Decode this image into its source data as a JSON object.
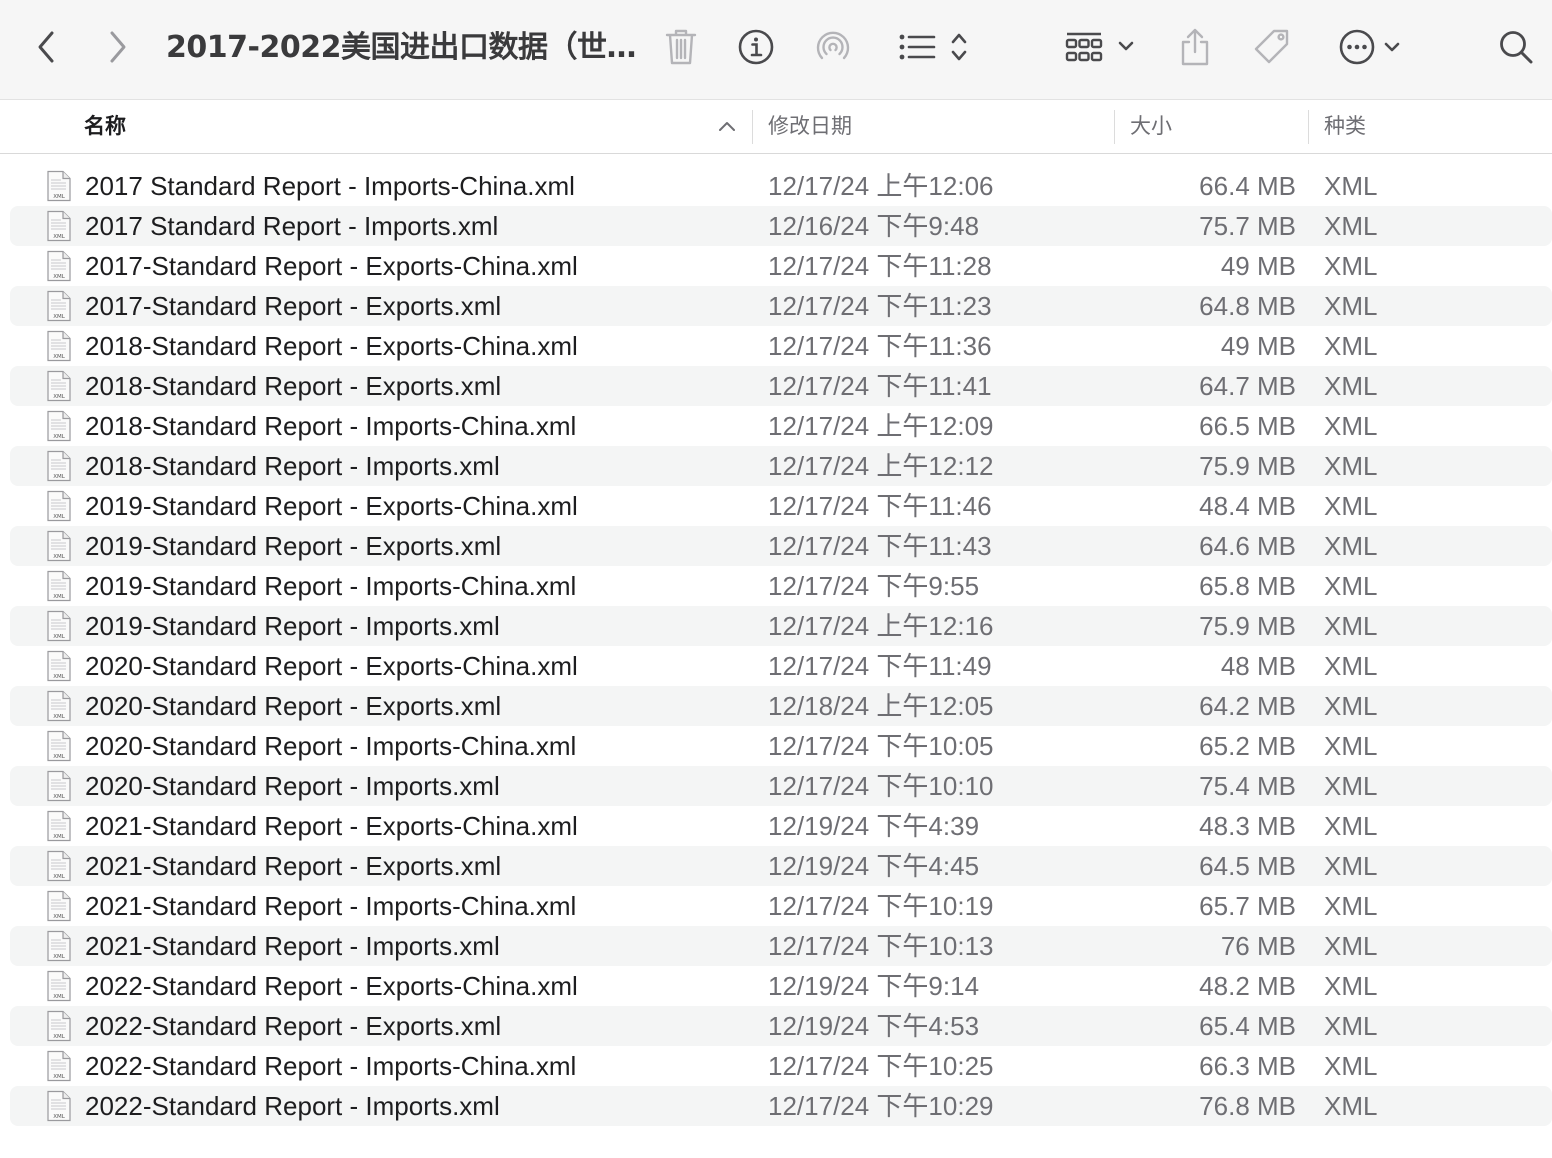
{
  "window": {
    "title": "2017-2022美国进出口数据（世…"
  },
  "icons": {
    "back": "chevron-left-icon",
    "forward": "chevron-right-icon",
    "trash": "trash-icon",
    "info": "info-icon",
    "airdrop": "airdrop-icon",
    "list_view": "list-view-icon",
    "group": "group-icon",
    "share": "share-icon",
    "tag": "tag-icon",
    "more": "more-icon",
    "search": "search-icon"
  },
  "columns": {
    "name": "名称",
    "date": "修改日期",
    "size": "大小",
    "kind": "种类"
  },
  "files": [
    {
      "name": "2017 Standard Report - Imports-China.xml",
      "date": "12/17/24 上午12:06",
      "size": "66.4 MB",
      "kind": "XML"
    },
    {
      "name": "2017 Standard Report - Imports.xml",
      "date": "12/16/24 下午9:48",
      "size": "75.7 MB",
      "kind": "XML"
    },
    {
      "name": "2017-Standard Report - Exports-China.xml",
      "date": "12/17/24 下午11:28",
      "size": "49 MB",
      "kind": "XML"
    },
    {
      "name": "2017-Standard Report - Exports.xml",
      "date": "12/17/24 下午11:23",
      "size": "64.8 MB",
      "kind": "XML"
    },
    {
      "name": "2018-Standard Report - Exports-China.xml",
      "date": "12/17/24 下午11:36",
      "size": "49 MB",
      "kind": "XML"
    },
    {
      "name": "2018-Standard Report - Exports.xml",
      "date": "12/17/24 下午11:41",
      "size": "64.7 MB",
      "kind": "XML"
    },
    {
      "name": "2018-Standard Report - Imports-China.xml",
      "date": "12/17/24 上午12:09",
      "size": "66.5 MB",
      "kind": "XML"
    },
    {
      "name": "2018-Standard Report - Imports.xml",
      "date": "12/17/24 上午12:12",
      "size": "75.9 MB",
      "kind": "XML"
    },
    {
      "name": "2019-Standard Report - Exports-China.xml",
      "date": "12/17/24 下午11:46",
      "size": "48.4 MB",
      "kind": "XML"
    },
    {
      "name": "2019-Standard Report - Exports.xml",
      "date": "12/17/24 下午11:43",
      "size": "64.6 MB",
      "kind": "XML"
    },
    {
      "name": "2019-Standard Report - Imports-China.xml",
      "date": "12/17/24 下午9:55",
      "size": "65.8 MB",
      "kind": "XML"
    },
    {
      "name": "2019-Standard Report - Imports.xml",
      "date": "12/17/24 上午12:16",
      "size": "75.9 MB",
      "kind": "XML"
    },
    {
      "name": "2020-Standard Report - Exports-China.xml",
      "date": "12/17/24 下午11:49",
      "size": "48 MB",
      "kind": "XML"
    },
    {
      "name": "2020-Standard Report - Exports.xml",
      "date": "12/18/24 上午12:05",
      "size": "64.2 MB",
      "kind": "XML"
    },
    {
      "name": "2020-Standard Report - Imports-China.xml",
      "date": "12/17/24 下午10:05",
      "size": "65.2 MB",
      "kind": "XML"
    },
    {
      "name": "2020-Standard Report - Imports.xml",
      "date": "12/17/24 下午10:10",
      "size": "75.4 MB",
      "kind": "XML"
    },
    {
      "name": "2021-Standard Report - Exports-China.xml",
      "date": "12/19/24 下午4:39",
      "size": "48.3 MB",
      "kind": "XML"
    },
    {
      "name": "2021-Standard Report - Exports.xml",
      "date": "12/19/24 下午4:45",
      "size": "64.5 MB",
      "kind": "XML"
    },
    {
      "name": "2021-Standard Report - Imports-China.xml",
      "date": "12/17/24 下午10:19",
      "size": "65.7 MB",
      "kind": "XML"
    },
    {
      "name": "2021-Standard Report - Imports.xml",
      "date": "12/17/24 下午10:13",
      "size": "76 MB",
      "kind": "XML"
    },
    {
      "name": "2022-Standard Report - Exports-China.xml",
      "date": "12/19/24 下午9:14",
      "size": "48.2 MB",
      "kind": "XML"
    },
    {
      "name": "2022-Standard Report - Exports.xml",
      "date": "12/19/24 下午4:53",
      "size": "65.4 MB",
      "kind": "XML"
    },
    {
      "name": "2022-Standard Report - Imports-China.xml",
      "date": "12/17/24 下午10:25",
      "size": "66.3 MB",
      "kind": "XML"
    },
    {
      "name": "2022-Standard Report - Imports.xml",
      "date": "12/17/24 下午10:29",
      "size": "76.8 MB",
      "kind": "XML"
    }
  ]
}
